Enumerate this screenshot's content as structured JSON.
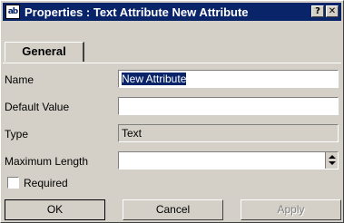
{
  "window": {
    "title": "Properties : Text Attribute New Attribute",
    "app_icon": "ab",
    "help_glyph": "?",
    "close_glyph": "✕"
  },
  "tabs": [
    {
      "label": "General"
    }
  ],
  "fields": {
    "name": {
      "label": "Name",
      "value": "New Attribute"
    },
    "default_value": {
      "label": "Default Value",
      "value": ""
    },
    "type": {
      "label": "Type",
      "value": "Text"
    },
    "max_length": {
      "label": "Maximum Length",
      "value": ""
    }
  },
  "required": {
    "label": "Required",
    "checked": false
  },
  "buttons": {
    "ok": "OK",
    "cancel": "Cancel",
    "apply": "Apply"
  },
  "colors": {
    "titlebar": "#0a246a",
    "face": "#d4d0c8",
    "selection": "#0a246a"
  }
}
